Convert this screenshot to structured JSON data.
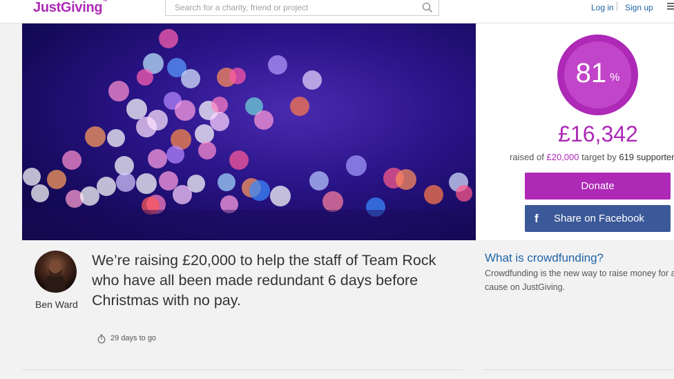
{
  "header": {
    "logo_text": "JustGiving",
    "logo_mark": "™",
    "search_placeholder": "Search for a charity, friend or project",
    "login_label": "Log in",
    "signup_label": "Sign up"
  },
  "campaign": {
    "progress_percent": 81,
    "percent_number": "81",
    "percent_sign": "%",
    "raised_amount": "£16,342",
    "raised_prefix": "raised of",
    "target_amount": "£20,000",
    "target_suffix": "target by",
    "supporters_count": "619",
    "supporters_label": "supporters",
    "donate_label": "Donate",
    "facebook_icon_glyph": "f",
    "facebook_label": "Share on Facebook",
    "owner_name": "Ben Ward",
    "headline": "We’re raising £20,000 to help the staff of Team Rock who have all been made redundant 6 days before Christmas with no pay.",
    "days_left": "29 days to go"
  },
  "crowdfunding": {
    "title": "What is crowdfunding?",
    "text": "Crowdfunding is the new way to raise money for a cause on JustGiving."
  },
  "colors": {
    "brand": "#ad29b6",
    "facebook": "#3b5998",
    "link": "#1f63a6"
  },
  "icons": [
    "search-icon",
    "menu-icon",
    "facebook-icon",
    "timer-icon"
  ]
}
